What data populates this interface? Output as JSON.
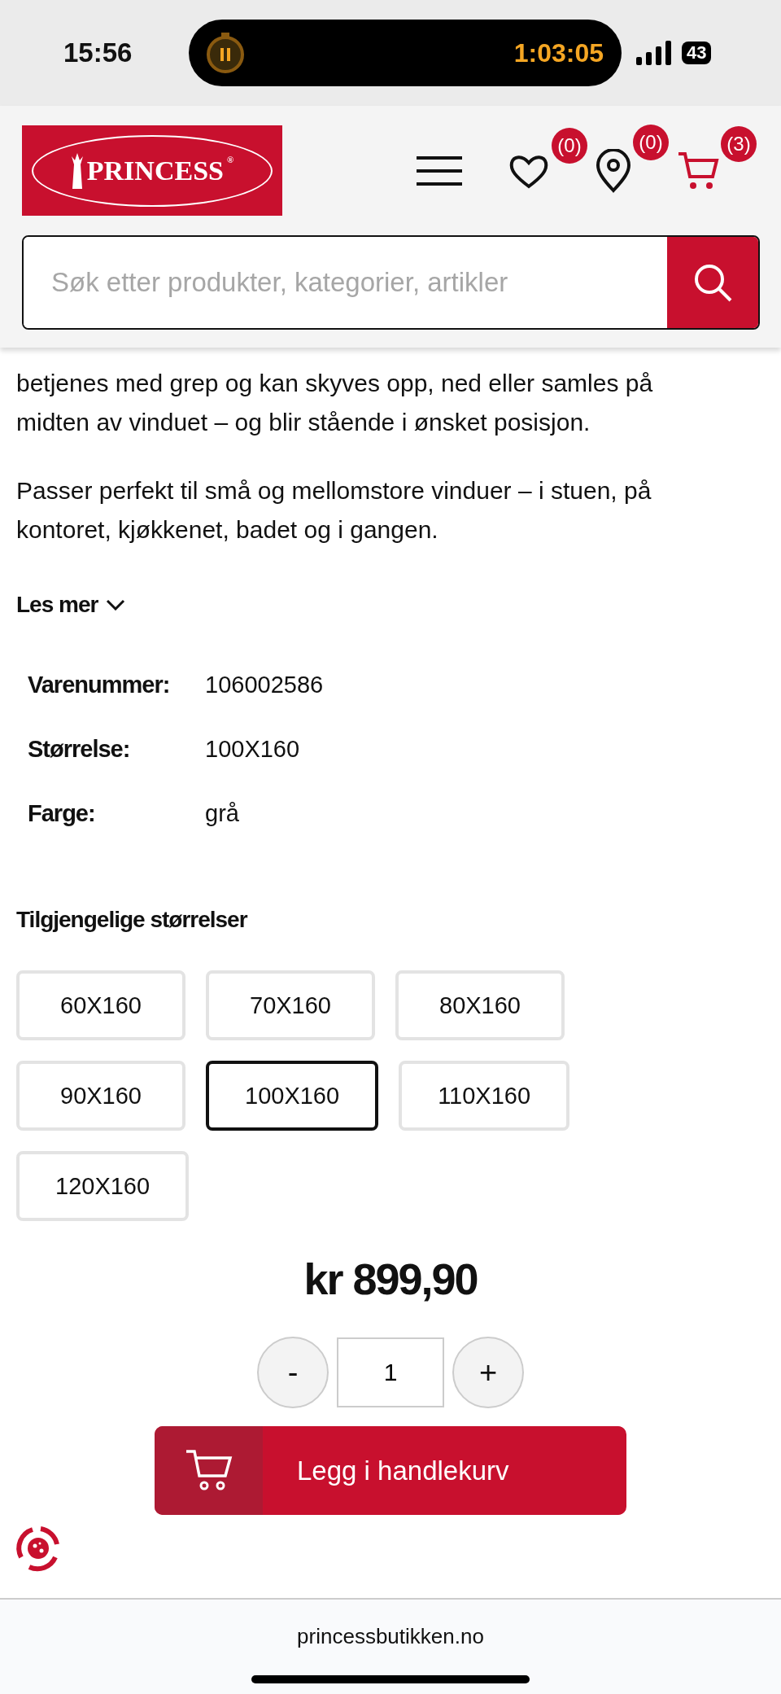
{
  "status_bar": {
    "time": "15:56",
    "timer": "1:03:05",
    "battery": "43"
  },
  "header": {
    "logo": "PRINCESS",
    "logo_mark": "®",
    "badges": [
      {
        "kind": "wishlist",
        "count": "(0)"
      },
      {
        "kind": "stores",
        "count": "(0)"
      },
      {
        "kind": "cart",
        "count": "(3)"
      }
    ]
  },
  "search": {
    "placeholder": "Søk etter produkter, kategorier, artikler"
  },
  "description": [
    "betjenes med grep og kan skyves opp, ned eller samles på midten av vinduet – og blir stående i ønsket posisjon.",
    "Passer perfekt til små og mellomstore vinduer – i stuen, på kontoret, kjøkkenet, badet og i gangen."
  ],
  "read_more": "Les mer",
  "specs": [
    {
      "label": "Varenummer:",
      "value": "106002586"
    },
    {
      "label": "Størrelse:",
      "value": "100X160"
    },
    {
      "label": "Farge:",
      "value": "grå"
    }
  ],
  "sizes": {
    "heading": "Tilgjengelige størrelser",
    "options": [
      {
        "label": "60X160",
        "selected": false
      },
      {
        "label": "70X160",
        "selected": false
      },
      {
        "label": "80X160",
        "selected": false
      },
      {
        "label": "90X160",
        "selected": false
      },
      {
        "label": "100X160",
        "selected": true
      },
      {
        "label": "110X160",
        "selected": false
      },
      {
        "label": "120X160",
        "selected": false
      }
    ]
  },
  "price": "kr 899,90",
  "quantity": {
    "minus": "-",
    "value": "1",
    "plus": "+"
  },
  "add_to_cart": "Legg i handlekurv",
  "browser": {
    "url": "princessbutikken.no"
  }
}
